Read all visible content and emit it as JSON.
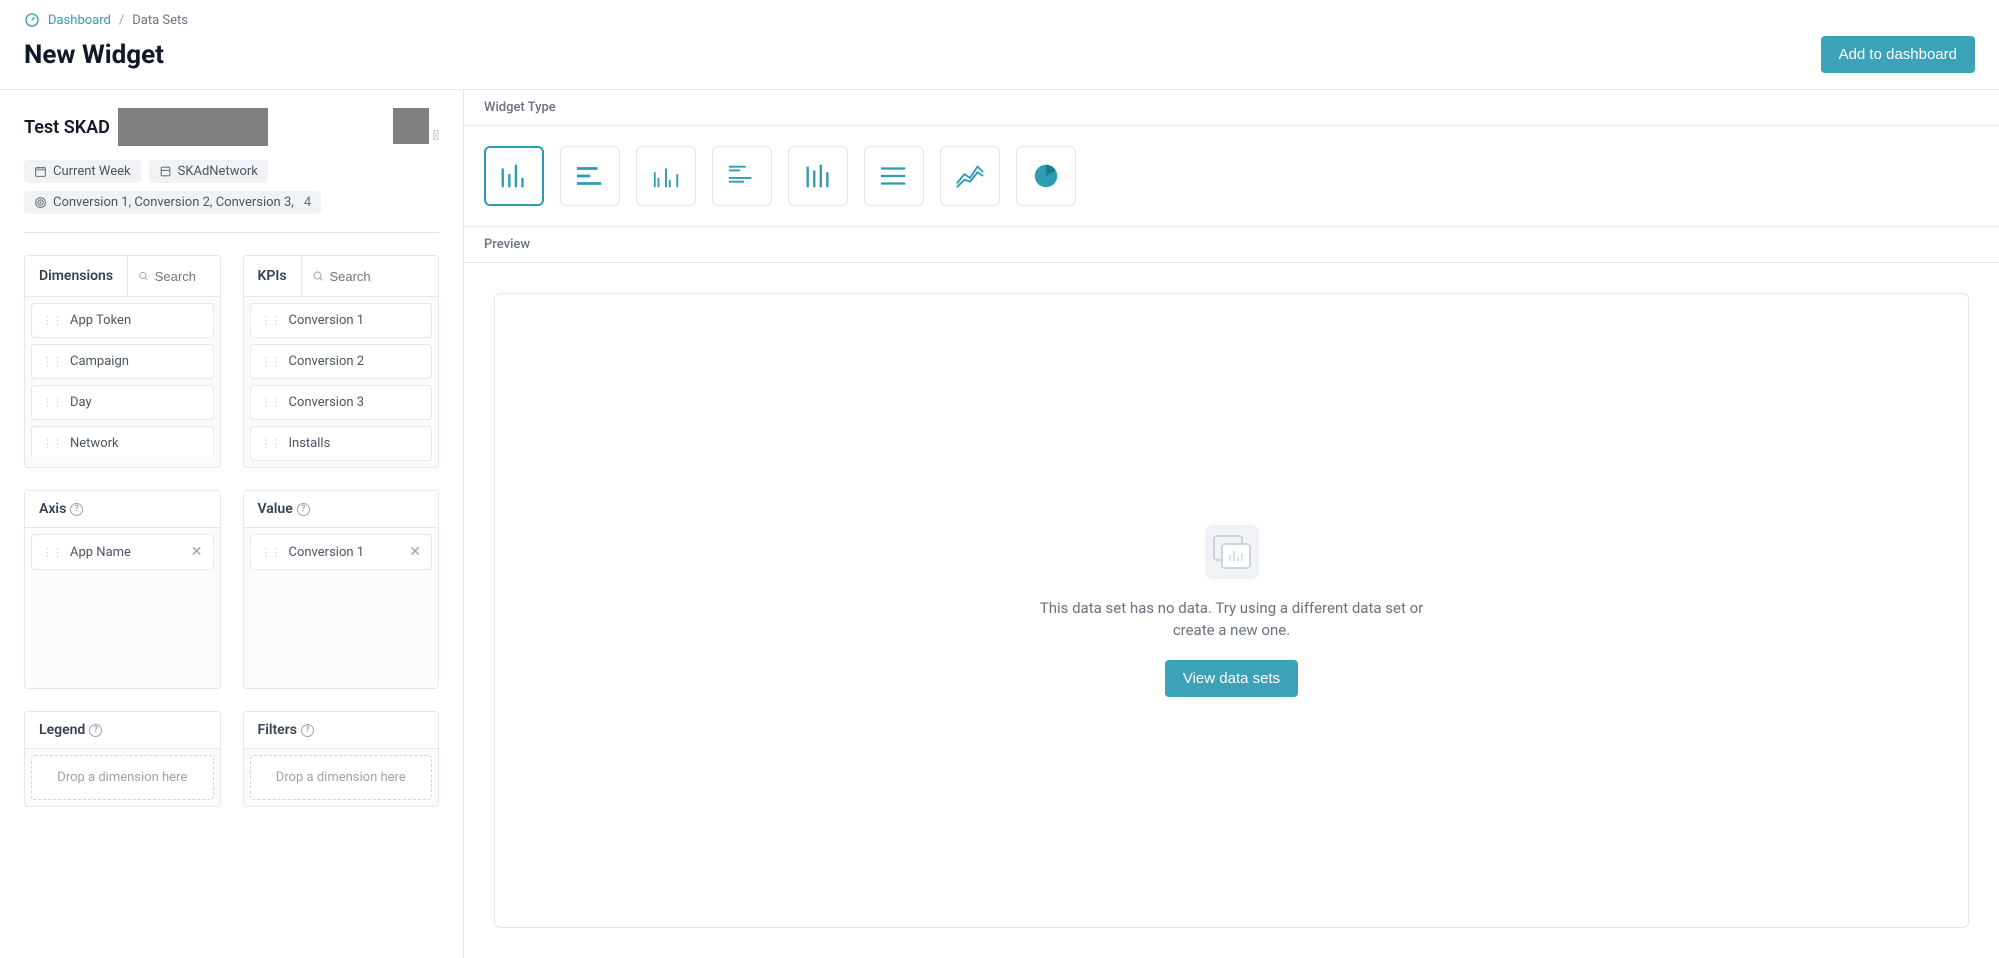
{
  "breadcrumb": {
    "dashboard": "Dashboard",
    "datasets": "Data Sets"
  },
  "page_title": "New Widget",
  "add_button": "Add to dashboard",
  "dataset": {
    "name": "Test SKAD",
    "chips": {
      "period": "Current Week",
      "source": "SKAdNetwork",
      "conversions": "Conversion 1, Conversion 2, Conversion 3,",
      "conv_count": "4"
    }
  },
  "panels": {
    "dimensions": {
      "title": "Dimensions",
      "search_ph": "Search",
      "items": [
        "App Token",
        "Campaign",
        "Day",
        "Network"
      ]
    },
    "kpis": {
      "title": "KPIs",
      "search_ph": "Search",
      "items": [
        "Conversion 1",
        "Conversion 2",
        "Conversion 3",
        "Installs"
      ]
    },
    "axis": {
      "title": "Axis",
      "items": [
        "App Name"
      ]
    },
    "value": {
      "title": "Value",
      "items": [
        "Conversion 1"
      ]
    },
    "legend": {
      "title": "Legend",
      "drop_hint": "Drop a dimension here"
    },
    "filters": {
      "title": "Filters",
      "drop_hint": "Drop a dimension here"
    }
  },
  "right": {
    "widget_type": "Widget Type",
    "preview": "Preview",
    "empty_message": "This data set has no data. Try using a different data set or create a new one.",
    "view_btn": "View data sets"
  }
}
